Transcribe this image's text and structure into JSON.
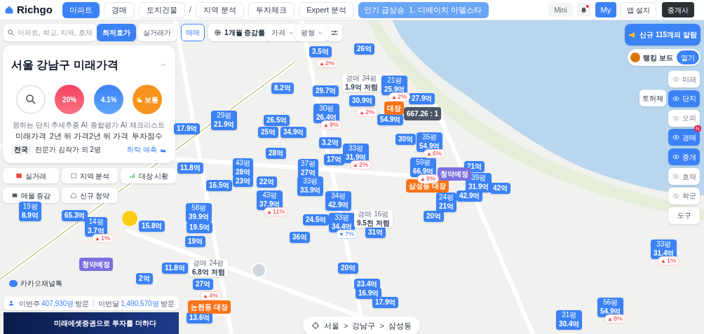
{
  "header": {
    "logo": "Richgo",
    "tabs": [
      {
        "label": "아파트",
        "selected": true
      },
      {
        "label": "경매",
        "selected": false
      },
      {
        "label": "토지건물",
        "selected": false
      },
      {
        "label": "지역 분석",
        "selected": false
      },
      {
        "label": "투자체크",
        "selected": false
      },
      {
        "label": "Expert 분석",
        "selected": false
      }
    ],
    "separator": "/",
    "trending": "인기 급상승  1. 디에이치 아델스타",
    "mini": "Mini",
    "notification_dot": true,
    "my": "My",
    "app_install": "앱 설치",
    "agent": "중개사"
  },
  "filters": {
    "search_placeholder": "아파트, 학교, 지역, 호재",
    "price_modes": [
      {
        "label": "최저호가",
        "selected": true
      },
      {
        "label": "실거래가",
        "selected": false
      }
    ],
    "deal_type": "매매",
    "change_period": "1개월 증감률",
    "dropdowns": [
      "가격",
      "평형"
    ]
  },
  "future_price_card": {
    "title": "서울 강남구 미래가격",
    "items": [
      {
        "kind": "search",
        "caption": "원하는 단지",
        "label": "미래가격"
      },
      {
        "kind": "up",
        "value": "20%",
        "caption": "추세추종 AI",
        "label": "2년 뒤 가격"
      },
      {
        "kind": "down",
        "value": "4.1%",
        "caption": "종합평가 AI",
        "label": "2년 뒤 가격"
      },
      {
        "kind": "weather",
        "value": "보통",
        "caption": "체크리스트",
        "label": "투자점수"
      }
    ],
    "scope": "전국",
    "experts": "전문가 김작가 외 2명",
    "forecast_link": "하락 예측"
  },
  "quick_buttons": [
    {
      "kind": "deal",
      "label": "실거래"
    },
    {
      "kind": "region",
      "label": "지역 분석"
    },
    {
      "kind": "leader",
      "label": "대장 시황"
    },
    {
      "kind": "listing",
      "label": "매물 증감"
    },
    {
      "kind": "subscription",
      "label": "신규 청약"
    }
  ],
  "markers": [
    {
      "price": "3.5억",
      "change": "2%",
      "rising": true
    },
    {
      "price": "26억"
    },
    {
      "price": "8.2억"
    },
    {
      "price": "29.7억"
    },
    {
      "size": "21평",
      "price": "25.9억",
      "change": "2%",
      "rising": true
    },
    {
      "price": "17.9억"
    },
    {
      "size": "29평",
      "price": "21.9억"
    },
    {
      "price": "26.5억"
    },
    {
      "size": "30평",
      "price": "26.4억",
      "change": "9%",
      "rising": true
    },
    {
      "price": "30.9억",
      "change": "2%",
      "rising": true
    },
    {
      "price": "54.9억"
    },
    {
      "price": "27.9억"
    },
    {
      "price": "25억"
    },
    {
      "price": "34.9억"
    },
    {
      "price": "3.2억"
    },
    {
      "price": "30억"
    },
    {
      "size": "35평",
      "price": "54.9억",
      "change": "6%",
      "rising": true
    },
    {
      "price": "11.8억"
    },
    {
      "size": "43평",
      "price": "28억"
    },
    {
      "price": "28억"
    },
    {
      "size": "37평",
      "price": "27억"
    },
    {
      "price": "17억"
    },
    {
      "size": "33평",
      "price": "31.9억",
      "change": "2%",
      "rising": true
    },
    {
      "size": "59평",
      "price": "66.9억",
      "change": "8%",
      "rising": true
    },
    {
      "price": "21억"
    },
    {
      "price": "16.5억"
    },
    {
      "price": "23억"
    },
    {
      "price": "22억"
    },
    {
      "size": "33평",
      "price": "33.9억"
    },
    {
      "size": "39평",
      "price": "31.9억"
    },
    {
      "size": "19평",
      "price": "8.9억"
    },
    {
      "price": "65.3억"
    },
    {
      "size": "14평",
      "price": "3.7억",
      "change": "1%",
      "rising": true
    },
    {
      "price": "15.8억"
    },
    {
      "size": "58평",
      "price": "39.9억"
    },
    {
      "price": "19.5억"
    },
    {
      "size": "43평",
      "price": "37.9억",
      "change": "11%",
      "rising": true
    },
    {
      "price": "24.5억"
    },
    {
      "size": "34평",
      "price": "42.9억"
    },
    {
      "size": "33평",
      "price": "34.4억",
      "change": "7%",
      "rising": false
    },
    {
      "price": "20억"
    },
    {
      "size": "24평",
      "price": "21억"
    },
    {
      "price": "42.9억"
    },
    {
      "price": "42억"
    },
    {
      "price": "19억"
    },
    {
      "price": "36억"
    },
    {
      "price": "31억"
    },
    {
      "size": "33평",
      "price": "31.4억",
      "change": "1%",
      "rising": true
    },
    {
      "price": "11.8억"
    },
    {
      "price": "20억"
    },
    {
      "price": "2억"
    },
    {
      "price": "27억",
      "change": "4%",
      "rising": true
    },
    {
      "price": "23.4억"
    },
    {
      "price": "16.9억"
    },
    {
      "price": "13.6억"
    },
    {
      "price": "17.9억"
    },
    {
      "size": "31평",
      "price": "30.4억"
    },
    {
      "size": "56평",
      "price": "54.9억",
      "change": "8%",
      "rising": true
    }
  ],
  "map_tags": [
    {
      "text": "대장",
      "color": "#f97316"
    },
    {
      "text": "삼성동 대장",
      "color": "#f97316"
    },
    {
      "text": "청약예정",
      "color": "#7c6fe0"
    },
    {
      "text": "청약예정",
      "color": "#7c6fe0"
    },
    {
      "text": "논현동 대장",
      "color": "#f97316"
    },
    {
      "text": "667.26 : 1",
      "color": "#4b5563"
    }
  ],
  "auction_notes": [
    {
      "label": "경매 34평",
      "text": "1.9억 저렴"
    },
    {
      "label": "경매 16평",
      "text": "9.5천 저렴"
    },
    {
      "label": "경매 24평",
      "text": "6.8억 저렴"
    }
  ],
  "kakao_button": "카카오채널톡",
  "visitors": [
    {
      "period": "이번주",
      "count": "407,930명",
      "suffix": "방문"
    },
    {
      "period": "이번달",
      "count": "1,490,570명",
      "suffix": "방문"
    }
  ],
  "ad_banner": {
    "headline": "미래에셋증권으로 투자를 더하다"
  },
  "breadcrumb": {
    "items": [
      "서울",
      "강남구",
      "삼성동"
    ],
    "separator": ">"
  },
  "right_panel": {
    "alarm": "신규 115개의 알람",
    "ranking": "랭킹 보드",
    "ranking_open": "열기",
    "land_permit": "토허제",
    "layers": [
      {
        "kind": "toggle",
        "label": "미래",
        "on": false
      },
      {
        "kind": "toggle",
        "label": "단지",
        "on": true
      },
      {
        "kind": "toggle",
        "label": "오피",
        "on": false
      },
      {
        "kind": "toggle",
        "label": "경매",
        "on": true,
        "badge": "N"
      },
      {
        "kind": "toggle",
        "label": "중개",
        "on": true
      },
      {
        "kind": "toggle",
        "label": "호재",
        "on": false
      },
      {
        "kind": "toggle",
        "label": "학군",
        "on": false
      },
      {
        "kind": "tool",
        "label": "도구"
      }
    ]
  }
}
